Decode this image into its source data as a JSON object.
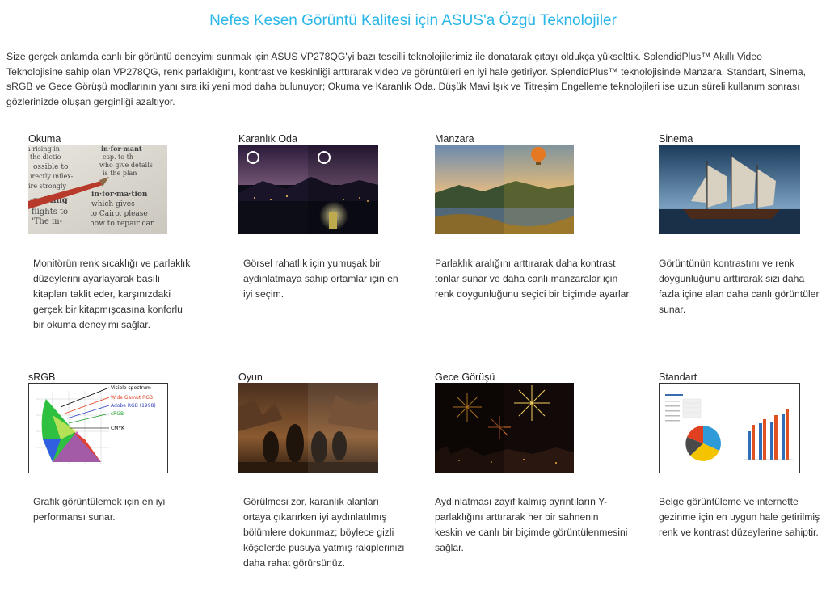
{
  "page": {
    "title": "Nefes Kesen Görüntü Kalitesi için ASUS'a Özgü Teknolojiler",
    "intro": "Size gerçek anlamda canlı bir görüntü deneyimi sunmak için ASUS VP278QG'yi bazı tescilli teknolojilerimiz ile donatarak çıtayı oldukça yükselttik. SplendidPlus™ Akıllı Video Teknolojisine sahip olan VP278QG, renk parlaklığını, kontrast ve keskinliği arttırarak video ve görüntüleri en iyi hale getiriyor. SplendidPlus™ teknolojisinde Manzara, Standart, Sinema, sRGB ve Gece Görüşü modlarının yanı sıra iki yeni mod daha bulunuyor; Okuma ve Karanlık Oda. Düşük Mavi Işık ve Titreşim Engelleme teknolojileri ise uzun süreli kullanım sonrası gözlerinizde oluşan gerginliği azaltıyor."
  },
  "modes": [
    {
      "name": "Okuma",
      "image": "reading-dictionary-image",
      "description": "Monitörün renk sıcaklığı ve parlaklık düzeylerini ayarlayarak basılı kitapları taklit eder, karşınızdaki gerçek bir kitapmışcasına konforlu bir okuma deneyimi sağlar."
    },
    {
      "name": "Karanlık Oda",
      "image": "dark-room-image",
      "description": "Görsel rahatlık için yumuşak bir aydınlatmaya sahip ortamlar için en iyi seçim."
    },
    {
      "name": "Manzara",
      "image": "landscape-image",
      "description": "Parlaklık aralığını arttırarak daha kontrast tonlar sunar ve daha canlı manzaralar için renk doygunluğunu seçici bir biçimde ayarlar."
    },
    {
      "name": "Sinema",
      "image": "cinema-ship-image",
      "description": "Görüntünün kontrastını ve renk doygunluğunu arttırarak sizi daha fazla içine alan daha canlı görüntüler sunar."
    },
    {
      "name": "sRGB",
      "image": "srgb-chart-image",
      "description": "Grafik görüntülemek için en iyi performansı sunar."
    },
    {
      "name": "Oyun",
      "image": "game-soldiers-image",
      "description": "Görülmesi zor, karanlık alanları ortaya çıkarırken iyi aydınlatılmış bölümlere dokunmaz; böylece gizli köşelerde pusuya yatmış rakiplerinizi daha rahat görürsünüz."
    },
    {
      "name": "Gece Görüşü",
      "image": "night-fireworks-image",
      "description": "Aydınlatması zayıf kalmış ayrıntıların Y-parlaklığını arttırarak her bir sahnenin keskin ve canlı bir biçimde görüntülenmesini sağlar."
    },
    {
      "name": "Standart",
      "image": "standard-document-image",
      "description": "Belge görüntüleme ve internette gezinme için en uygun hale getirilmiş renk ve kontrast düzeylerine sahiptir."
    }
  ],
  "srgb_legend": [
    "Visible spectrum",
    "Wide Gamut RGB",
    "Adobe RGB (1998)",
    "sRGB",
    "CMYK"
  ],
  "colors": {
    "accent": "#29b6e8",
    "text": "#333333"
  }
}
